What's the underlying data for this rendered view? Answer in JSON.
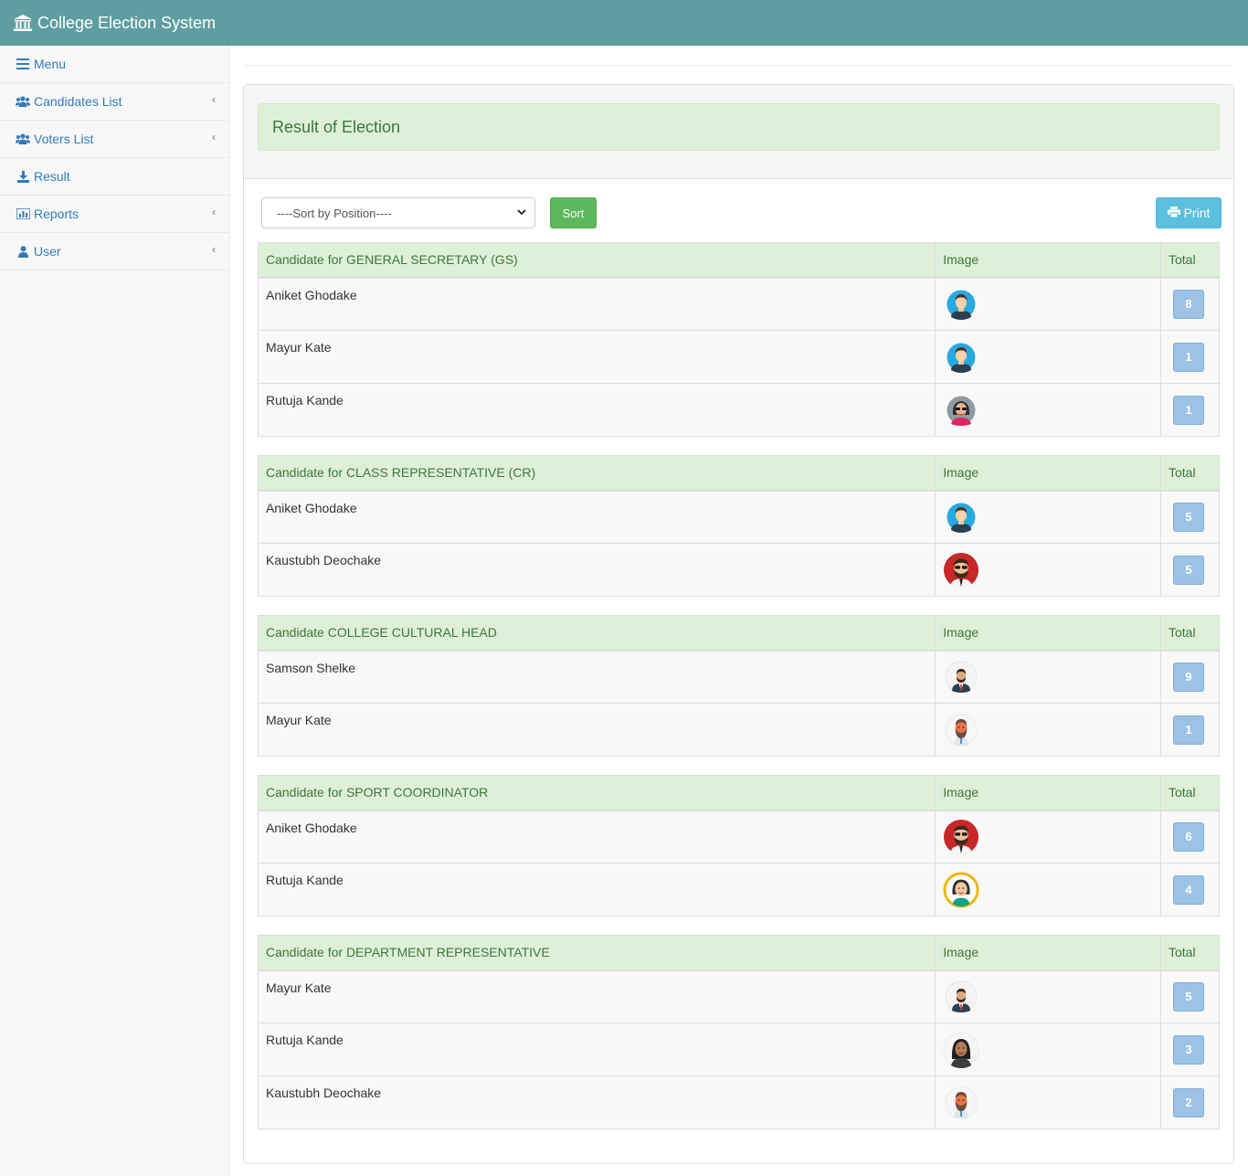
{
  "app": {
    "title": "College Election System"
  },
  "sidebar": {
    "items": [
      {
        "label": "Menu",
        "icon": "menu-icon"
      },
      {
        "label": "Candidates List",
        "icon": "users-icon"
      },
      {
        "label": "Voters List",
        "icon": "users-icon"
      },
      {
        "label": "Result",
        "icon": "download-icon"
      },
      {
        "label": "Reports",
        "icon": "bar-chart-icon"
      },
      {
        "label": "User",
        "icon": "user-icon"
      }
    ]
  },
  "page": {
    "title": "Result of Election"
  },
  "toolbar": {
    "sort_select_value": "----Sort by Position----",
    "sort_label": "Sort",
    "print_label": "Print"
  },
  "columns": {
    "image": "Image",
    "total": "Total"
  },
  "positions": [
    {
      "heading": "Candidate for GENERAL SECRETARY (GS)",
      "candidates": [
        {
          "name": "Aniket Ghodake",
          "total": "8",
          "avatar": "man-blue"
        },
        {
          "name": "Mayur Kate",
          "total": "1",
          "avatar": "man-blue"
        },
        {
          "name": "Rutuja Kande",
          "total": "1",
          "avatar": "woman-sunglasses"
        }
      ]
    },
    {
      "heading": "Candidate for CLASS REPRESENTATIVE (CR)",
      "candidates": [
        {
          "name": "Aniket Ghodake",
          "total": "5",
          "avatar": "man-blue"
        },
        {
          "name": "Kaustubh Deochake",
          "total": "5",
          "avatar": "man-red-sunglasses"
        }
      ]
    },
    {
      "heading": "Candidate COLLEGE CULTURAL HEAD",
      "candidates": [
        {
          "name": "Samson Shelke",
          "total": "9",
          "avatar": "man-suit"
        },
        {
          "name": "Mayur Kate",
          "total": "1",
          "avatar": "man-orange-beard"
        }
      ]
    },
    {
      "heading": "Candidate for SPORT COORDINATOR",
      "candidates": [
        {
          "name": "Aniket Ghodake",
          "total": "6",
          "avatar": "man-red-sunglasses"
        },
        {
          "name": "Rutuja Kande",
          "total": "4",
          "avatar": "woman-yellow"
        }
      ]
    },
    {
      "heading": "Candidate for DEPARTMENT REPRESENTATIVE",
      "candidates": [
        {
          "name": "Mayur Kate",
          "total": "5",
          "avatar": "man-suit"
        },
        {
          "name": "Rutuja Kande",
          "total": "3",
          "avatar": "woman-dark-hair"
        },
        {
          "name": "Kaustubh Deochake",
          "total": "2",
          "avatar": "man-orange-beard"
        }
      ]
    }
  ],
  "colors": {
    "topbar": "#5f9ea0",
    "link": "#337ab7",
    "header_bg": "#dff0d8",
    "header_text": "#3c763d",
    "sort_btn": "#5cb85c",
    "print_btn": "#5bc0de",
    "badge": "#9cc2e5"
  }
}
